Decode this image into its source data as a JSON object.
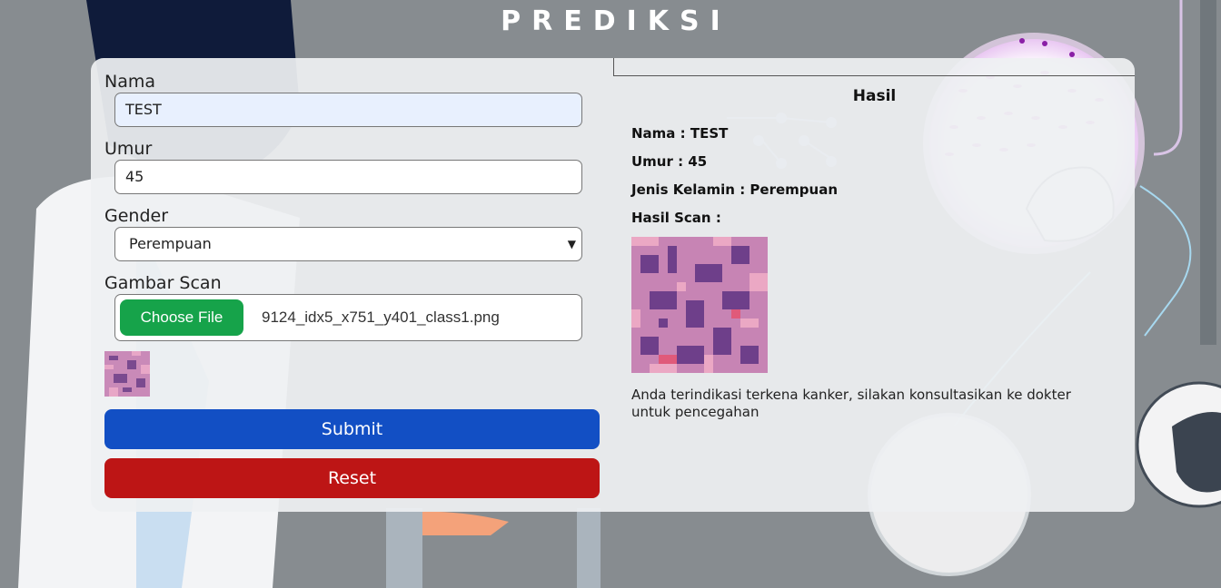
{
  "header": {
    "title": "PREDIKSI"
  },
  "form": {
    "name_label": "Nama",
    "name_value": "TEST",
    "age_label": "Umur",
    "age_value": "45",
    "gender_label": "Gender",
    "gender_value": "Perempuan",
    "scan_label": "Gambar Scan",
    "choose_file_label": "Choose File",
    "file_name": "9124_idx5_x751_y401_class1.png",
    "submit_label": "Submit",
    "reset_label": "Reset"
  },
  "result": {
    "title": "Hasil",
    "name_line": "Nama : TEST",
    "age_line": "Umur : 45",
    "gender_line": "Jenis Kelamin : Perempuan",
    "scan_line": "Hasil Scan :",
    "verdict": "Anda terindikasi terkena kanker, silakan konsultasikan ke dokter untuk pencegahan"
  },
  "colors": {
    "submit": "#124fc4",
    "reset": "#bd1515",
    "choose_file": "#16a34a"
  },
  "icons": [
    "chevron-down-icon"
  ]
}
